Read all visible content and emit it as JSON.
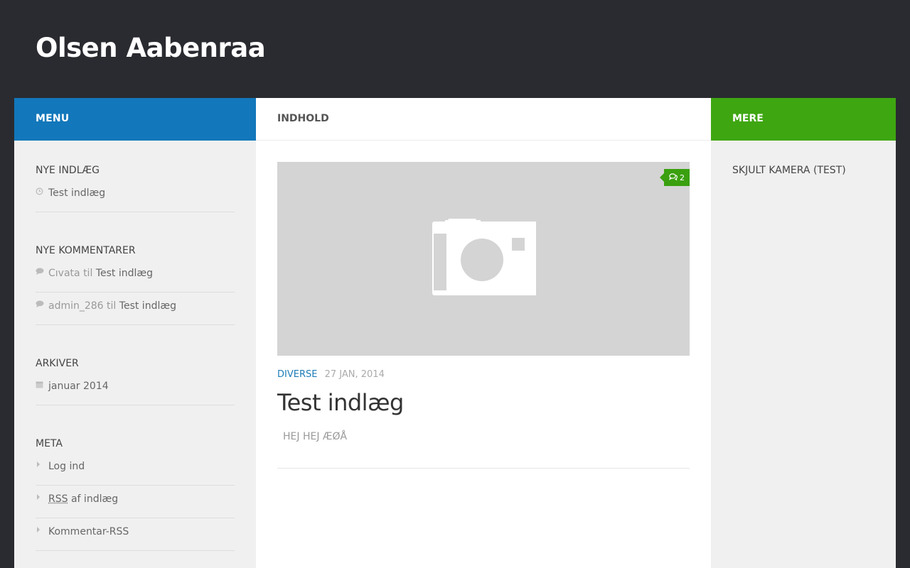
{
  "site": {
    "title": "Olsen Aabenraa"
  },
  "left": {
    "bar_label": "MENU",
    "recent_posts": {
      "title": "NYE INDLÆG",
      "items": [
        "Test indlæg"
      ]
    },
    "recent_comments": {
      "title": "NYE KOMMENTARER",
      "items": [
        {
          "author": "Cıvata",
          "joiner": "til",
          "post": "Test indlæg"
        },
        {
          "author": "admin_286",
          "joiner": "til",
          "post": "Test indlæg"
        }
      ]
    },
    "archives": {
      "title": "ARKIVER",
      "items": [
        "januar 2014"
      ]
    },
    "meta": {
      "title": "META",
      "items": [
        {
          "label": "Log ind"
        },
        {
          "abbr": "RSS",
          "rest": "af indlæg"
        },
        {
          "label": "Kommentar-RSS"
        }
      ]
    }
  },
  "main": {
    "bar_label": "INDHOLD",
    "post": {
      "comment_count": "2",
      "category": "DIVERSE",
      "date": "27 JAN, 2014",
      "title": "Test indlæg",
      "excerpt": "HEJ HEJ ÆØÅ"
    }
  },
  "right": {
    "bar_label": "MERE",
    "widget_title": "SKJULT KAMERA (TEST)"
  },
  "colors": {
    "header_bg": "#2a2b30",
    "menu_bar": "#1277bb",
    "more_bar": "#3ea611",
    "badge": "#3aa00f",
    "category": "#1e7db8"
  },
  "icons": {
    "clock": "clock-icon",
    "comment": "comment-icon",
    "calendar": "calendar-icon",
    "arrow": "caret-right-icon",
    "camera": "camera-placeholder-icon",
    "comments": "comments-icon"
  }
}
